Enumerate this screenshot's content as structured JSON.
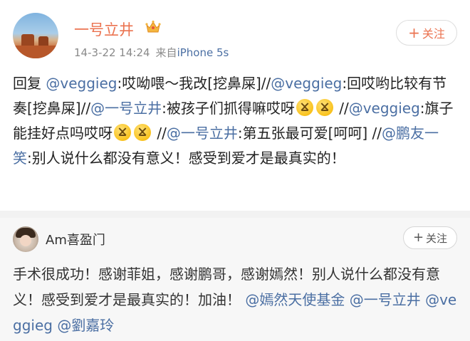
{
  "post": {
    "username": "一号立井",
    "timestamp": "14-3-22 14:24",
    "source_prefix": "来自",
    "device": "iPhone 5s",
    "follow_label": "关注",
    "crown_icon": "crown-icon",
    "text": {
      "p1": "回复 ",
      "m1": "@veggieg",
      "p2": ":哎呦喂～我改[挖鼻屎]//",
      "m2": "@veggieg",
      "p3": ":回哎哟比较有节奏[挖鼻屎]//",
      "m3": "@一号立井",
      "p4": ":被孩子们抓得嘛哎呀",
      "p5": " //",
      "m4": "@veggieg",
      "p6": ":旗子能挂好点吗哎呀",
      "p7": " //",
      "m5": "@一号立井",
      "p8": ":第五张最可爱[呵呵] //",
      "m6": "@鹏友一笑",
      "p9": ":别人说什么都没有意义！感受到爱才是最真实的！"
    }
  },
  "comment": {
    "username": "Am喜盈门",
    "follow_label": "关注",
    "text": {
      "p1": "手术很成功！感谢菲姐，感谢鹏哥，感谢嫣然！别人说什么都没有意义！感受到爱才是最真实的！加油！",
      "m1": "@嫣然天使基金",
      "m2": "@一号立井",
      "m3": "@veggieg",
      "m4": "@劉嘉玲"
    }
  },
  "colors": {
    "accent": "#eb7350",
    "link": "#4b6fa3",
    "meta": "#8a8a8a",
    "comment_bg": "#f7f7f7"
  }
}
